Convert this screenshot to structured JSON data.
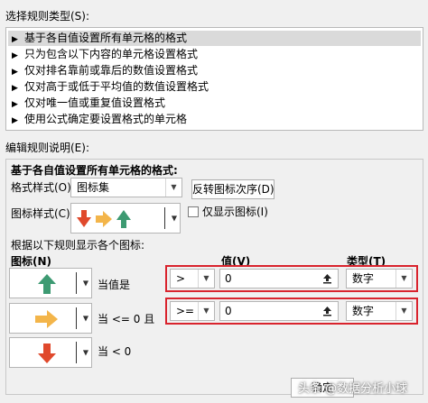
{
  "select_rule_type_label": "选择规则类型(S):",
  "rule_types": [
    "基于各自值设置所有单元格的格式",
    "只为包含以下内容的单元格设置格式",
    "仅对排名靠前或靠后的数值设置格式",
    "仅对高于或低于平均值的数值设置格式",
    "仅对唯一值或重复值设置格式",
    "使用公式确定要设置格式的单元格"
  ],
  "edit_rule_label": "编辑规则说明(E):",
  "format_all_heading": "基于各自值设置所有单元格的格式:",
  "format_style_label": "格式样式(O):",
  "format_style_value": "图标集",
  "reverse_button": "反转图标次序(D)",
  "icon_style_label": "图标样式(C):",
  "show_icon_only_label": "仅显示图标(I)",
  "rules_caption": "根据以下规则显示各个图标:",
  "col_icon": "图标(N)",
  "col_value": "值(V)",
  "col_type": "类型(T)",
  "rows": [
    {
      "condition": "当值是",
      "operator": ">",
      "value": "0",
      "type": "数字"
    },
    {
      "condition": "当 <= 0 且",
      "operator": ">=",
      "value": "0",
      "type": "数字"
    },
    {
      "condition": "当 < 0",
      "operator": "",
      "value": "",
      "type": ""
    }
  ],
  "ok_button": "确定",
  "watermark": "头条 @数据分析小球",
  "colors": {
    "green": "#3d9a72",
    "yellow": "#f3b54a",
    "red": "#e0492c",
    "highlight": "#d9232d"
  }
}
